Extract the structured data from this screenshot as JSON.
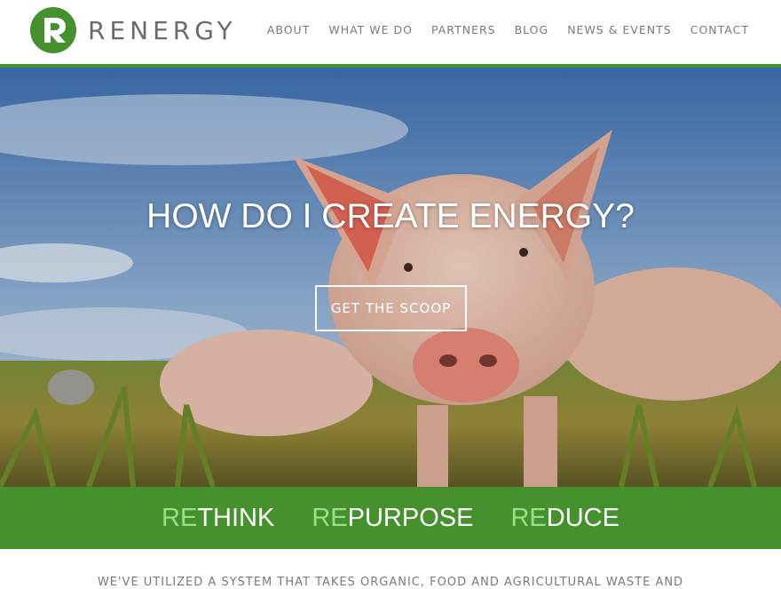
{
  "brand": {
    "name": "RENERGY",
    "color": "#44912e"
  },
  "nav": {
    "items": [
      {
        "label": "ABOUT"
      },
      {
        "label": "WHAT WE DO"
      },
      {
        "label": "PARTNERS"
      },
      {
        "label": "BLOG"
      },
      {
        "label": "NEWS & EVENTS"
      },
      {
        "label": "CONTACT"
      }
    ]
  },
  "hero": {
    "title": "HOW DO I CREATE ENERGY?",
    "button_label": "GET THE SCOOP"
  },
  "band": {
    "items": [
      {
        "prefix": "RE",
        "rest": "THINK"
      },
      {
        "prefix": "RE",
        "rest": "PURPOSE"
      },
      {
        "prefix": "RE",
        "rest": "DUCE"
      }
    ]
  },
  "intro": {
    "text": "WE'VE UTILIZED A SYSTEM THAT TAKES ORGANIC, FOOD AND AGRICULTURAL WASTE AND"
  }
}
